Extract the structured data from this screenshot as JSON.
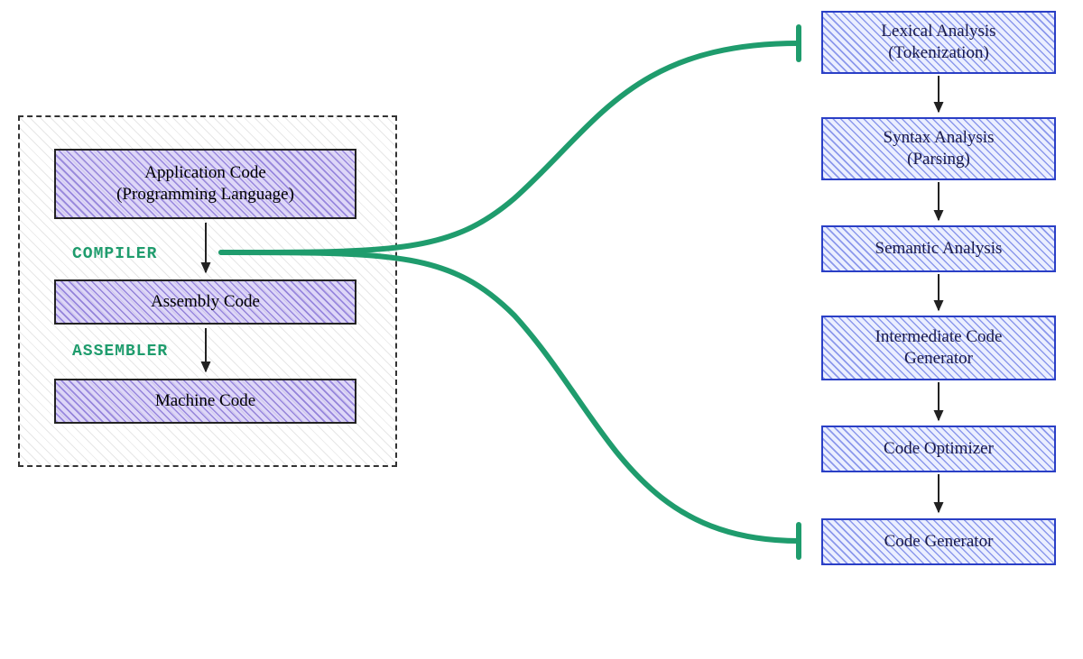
{
  "left": {
    "app_code": "Application Code\n(Programming Language)",
    "compiler_label": "COMPILER",
    "assembly_code": "Assembly Code",
    "assembler_label": "ASSEMBLER",
    "machine_code": "Machine Code"
  },
  "right": {
    "lexical": "Lexical Analysis\n(Tokenization)",
    "syntax": "Syntax Analysis\n(Parsing)",
    "semantic": "Semantic Analysis",
    "intermediate": "Intermediate Code\nGenerator",
    "optimizer": "Code Optimizer",
    "generator": "Code Generator"
  },
  "colors": {
    "green": "#1f9c6d",
    "blue": "#2a3fc6",
    "purple": "#7a66d8"
  }
}
